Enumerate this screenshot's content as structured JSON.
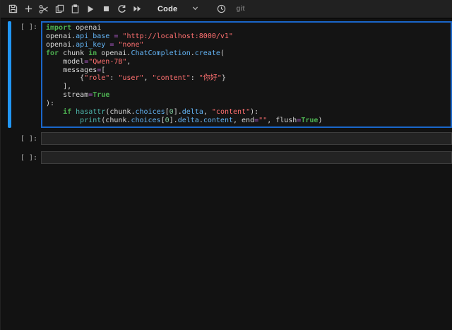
{
  "toolbar": {
    "cell_type": "Code",
    "git_label": "git",
    "icons": [
      "save-icon",
      "plus-icon",
      "scissors-icon",
      "copy-icon",
      "clipboard-icon",
      "play-icon",
      "stop-icon",
      "restart-icon",
      "fast-forward-icon",
      "chevron-down-icon",
      "clock-icon"
    ]
  },
  "colors": {
    "accent_blue": "#2196f3",
    "focused_border": "#1a66c9",
    "keyword": "#4caf50",
    "builtin": "#4db6ac",
    "property": "#64b5f6",
    "string": "#ff7070",
    "operator": "#b05ccc",
    "number": "#7ec699",
    "toolbar_bg": "#212121",
    "page_bg": "#121212"
  },
  "cells": [
    {
      "prompt": "[ ]:",
      "focused": true,
      "lines": [
        [
          [
            "k",
            "import"
          ],
          [
            "v",
            " openai"
          ]
        ],
        [
          [
            "v",
            "openai."
          ],
          [
            "p",
            "api_base"
          ],
          [
            "v",
            " "
          ],
          [
            "o",
            "="
          ],
          [
            "v",
            " "
          ],
          [
            "s",
            "\"http://localhost:8000/v1\""
          ]
        ],
        [
          [
            "v",
            "openai."
          ],
          [
            "p",
            "api_key"
          ],
          [
            "v",
            " "
          ],
          [
            "o",
            "="
          ],
          [
            "v",
            " "
          ],
          [
            "s",
            "\"none\""
          ]
        ],
        [
          [
            "k",
            "for"
          ],
          [
            "v",
            " chunk "
          ],
          [
            "k",
            "in"
          ],
          [
            "v",
            " openai."
          ],
          [
            "p",
            "ChatCompletion"
          ],
          [
            "v",
            "."
          ],
          [
            "p",
            "create"
          ],
          [
            "v",
            "("
          ]
        ],
        [
          [
            "v",
            "    model"
          ],
          [
            "o",
            "="
          ],
          [
            "s",
            "\"Qwen-7B\""
          ],
          [
            "v",
            ","
          ]
        ],
        [
          [
            "v",
            "    messages"
          ],
          [
            "o",
            "="
          ],
          [
            "v",
            "["
          ]
        ],
        [
          [
            "v",
            "        {"
          ],
          [
            "s",
            "\"role\""
          ],
          [
            "v",
            ": "
          ],
          [
            "s",
            "\"user\""
          ],
          [
            "v",
            ", "
          ],
          [
            "s",
            "\"content\""
          ],
          [
            "v",
            ": "
          ],
          [
            "s",
            "\"你好\""
          ],
          [
            "v",
            "}"
          ]
        ],
        [
          [
            "v",
            "    ],"
          ]
        ],
        [
          [
            "v",
            "    stream"
          ],
          [
            "o",
            "="
          ],
          [
            "k",
            "True"
          ]
        ],
        [
          [
            "v",
            "):"
          ]
        ],
        [
          [
            "v",
            "    "
          ],
          [
            "k",
            "if"
          ],
          [
            "v",
            " "
          ],
          [
            "b",
            "hasattr"
          ],
          [
            "v",
            "(chunk."
          ],
          [
            "p",
            "choices"
          ],
          [
            "v",
            "["
          ],
          [
            "n",
            "0"
          ],
          [
            "v",
            "]."
          ],
          [
            "p",
            "delta"
          ],
          [
            "v",
            ", "
          ],
          [
            "s",
            "\"content\""
          ],
          [
            "v",
            "):"
          ]
        ],
        [
          [
            "v",
            "        "
          ],
          [
            "b",
            "print"
          ],
          [
            "v",
            "(chunk."
          ],
          [
            "p",
            "choices"
          ],
          [
            "v",
            "["
          ],
          [
            "n",
            "0"
          ],
          [
            "v",
            "]."
          ],
          [
            "p",
            "delta"
          ],
          [
            "v",
            "."
          ],
          [
            "p",
            "content"
          ],
          [
            "v",
            ", end"
          ],
          [
            "o",
            "="
          ],
          [
            "s",
            "\"\""
          ],
          [
            "v",
            ", flush"
          ],
          [
            "o",
            "="
          ],
          [
            "k",
            "True"
          ],
          [
            "v",
            ")"
          ]
        ]
      ]
    },
    {
      "prompt": "[ ]:",
      "focused": false,
      "lines": []
    },
    {
      "prompt": "[ ]:",
      "focused": false,
      "lines": []
    }
  ]
}
